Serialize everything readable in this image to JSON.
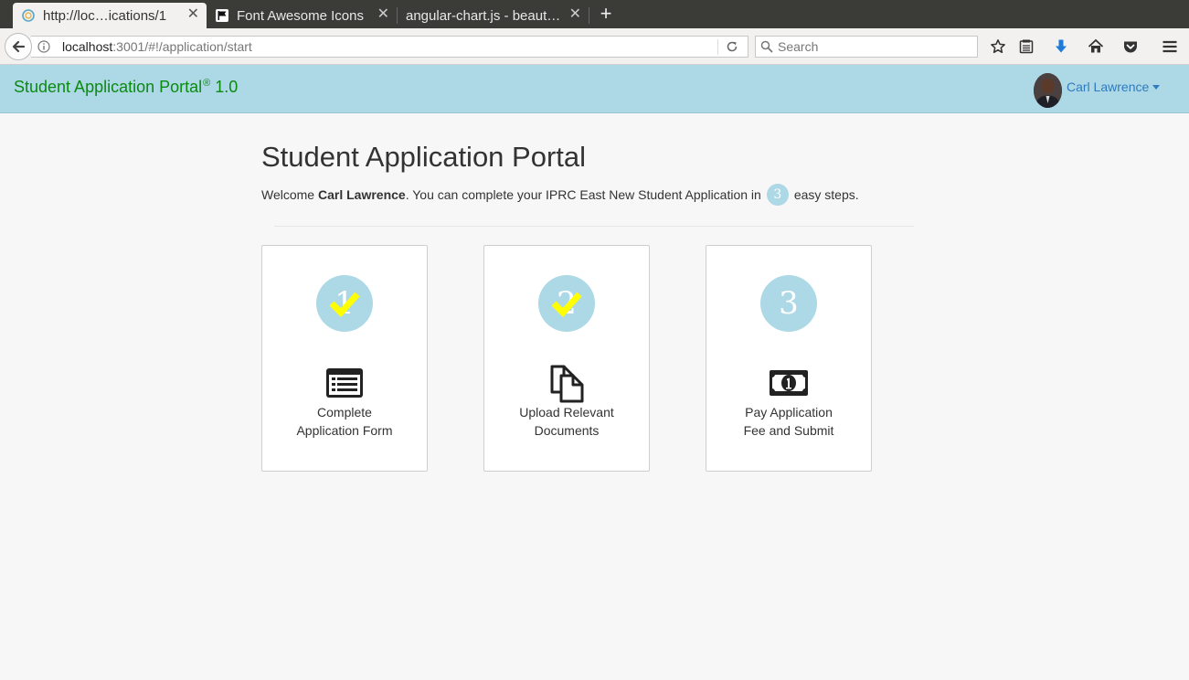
{
  "browser": {
    "tabs": [
      {
        "label": "http://loc…ications/1",
        "active": true,
        "favicon": "globe-icon"
      },
      {
        "label": "Font Awesome Icons",
        "active": false,
        "favicon": "flag-icon"
      },
      {
        "label": "angular-chart.js - beaut…",
        "active": false,
        "favicon": "none"
      }
    ],
    "url": {
      "host": "localhost",
      "rest": ":3001/#!/application/start"
    },
    "search_placeholder": "Search"
  },
  "app": {
    "brand": "Student Application Portal",
    "brand_mark": "®",
    "brand_version": "1.0",
    "user_name": "Carl Lawrence"
  },
  "main": {
    "title": "Student Application Portal",
    "welcome_prefix": "Welcome ",
    "welcome_name": "Carl Lawrence",
    "welcome_middle": ". You can complete your IPRC East New Student Application in",
    "steps_count": "3",
    "welcome_suffix": "easy steps."
  },
  "steps": [
    {
      "number": "1",
      "completed": true,
      "icon": "list-alt-icon",
      "line1": "Complete",
      "line2": "Application Form"
    },
    {
      "number": "2",
      "completed": true,
      "icon": "files-icon",
      "line1": "Upload Relevant",
      "line2": "Documents"
    },
    {
      "number": "3",
      "completed": false,
      "icon": "money-icon",
      "line1": "Pay Application",
      "line2": "Fee and Submit"
    }
  ],
  "colors": {
    "accent": "#add8e6",
    "brand_text": "#0b8a10",
    "link": "#2f7bbf",
    "check": "#ffff00"
  }
}
